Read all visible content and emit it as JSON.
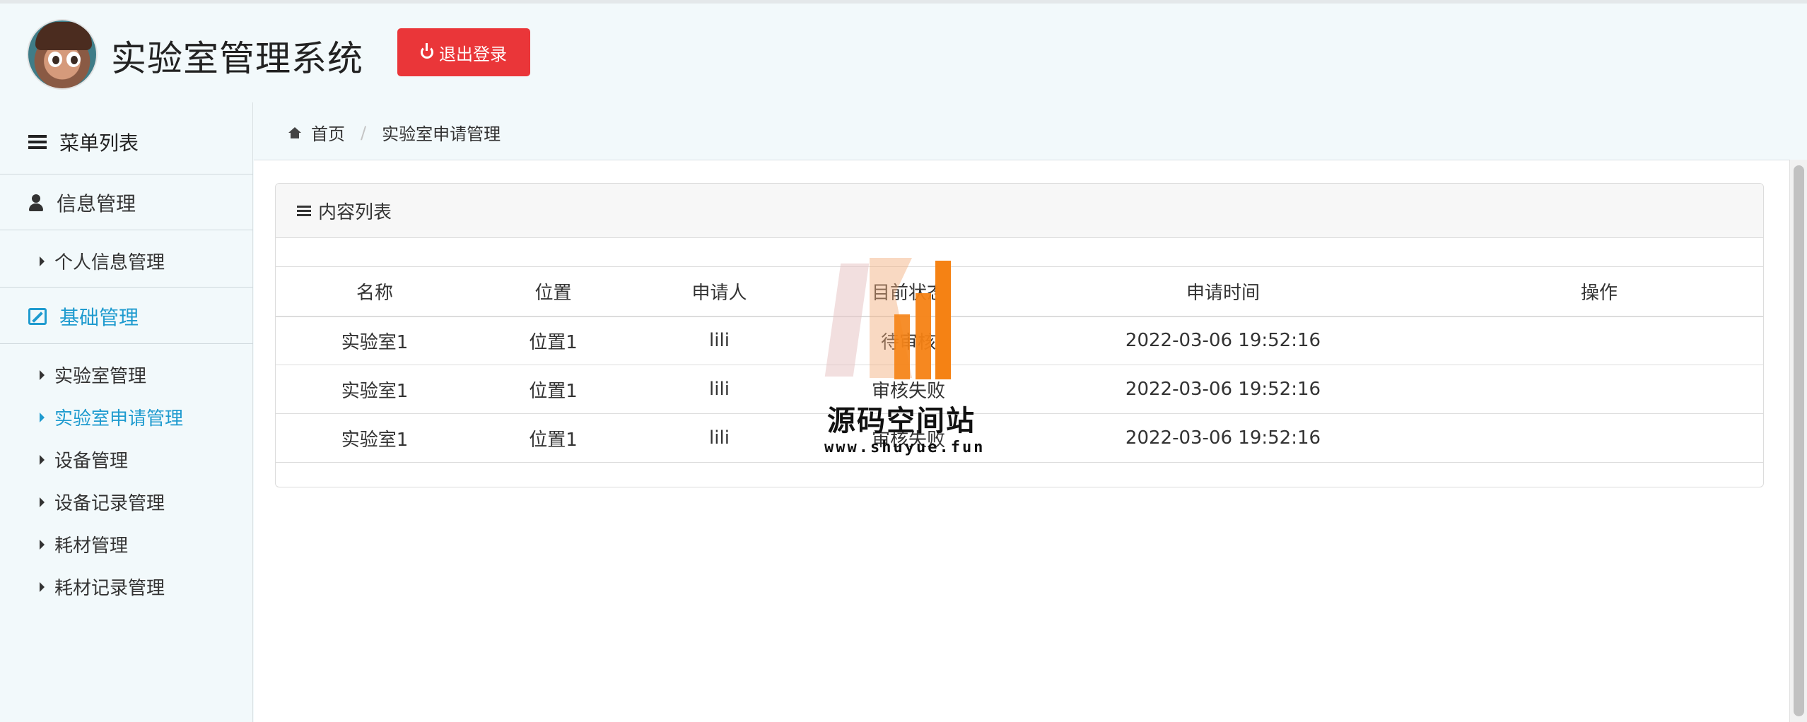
{
  "header": {
    "title": "实验室管理系统",
    "logout_label": "退出登录"
  },
  "sidebar": {
    "menu_title": "菜单列表",
    "groups": [
      {
        "label": "信息管理",
        "items": [
          "个人信息管理"
        ]
      },
      {
        "label": "基础管理",
        "items": [
          "实验室管理",
          "实验室申请管理",
          "设备管理",
          "设备记录管理",
          "耗材管理",
          "耗材记录管理"
        ]
      }
    ],
    "active_item": "实验室申请管理"
  },
  "breadcrumb": {
    "home": "首页",
    "current": "实验室申请管理"
  },
  "panel": {
    "title": "内容列表"
  },
  "table": {
    "columns": [
      "名称",
      "位置",
      "申请人",
      "目前状态",
      "申请时间",
      "操作"
    ],
    "rows": [
      [
        "实验室1",
        "位置1",
        "lili",
        "待审核",
        "2022-03-06 19:52:16",
        ""
      ],
      [
        "实验室1",
        "位置1",
        "lili",
        "审核失败",
        "2022-03-06 19:52:16",
        ""
      ],
      [
        "实验室1",
        "位置1",
        "lili",
        "审核失败",
        "2022-03-06 19:52:16",
        ""
      ]
    ]
  },
  "watermark": {
    "name": "源码空间站",
    "url": "www.shuyue.fun"
  },
  "colors": {
    "accent": "#1f9bcf",
    "logout_red": "#ea3639",
    "background": "#f2f9fb",
    "watermark_orange": "#f58214"
  }
}
